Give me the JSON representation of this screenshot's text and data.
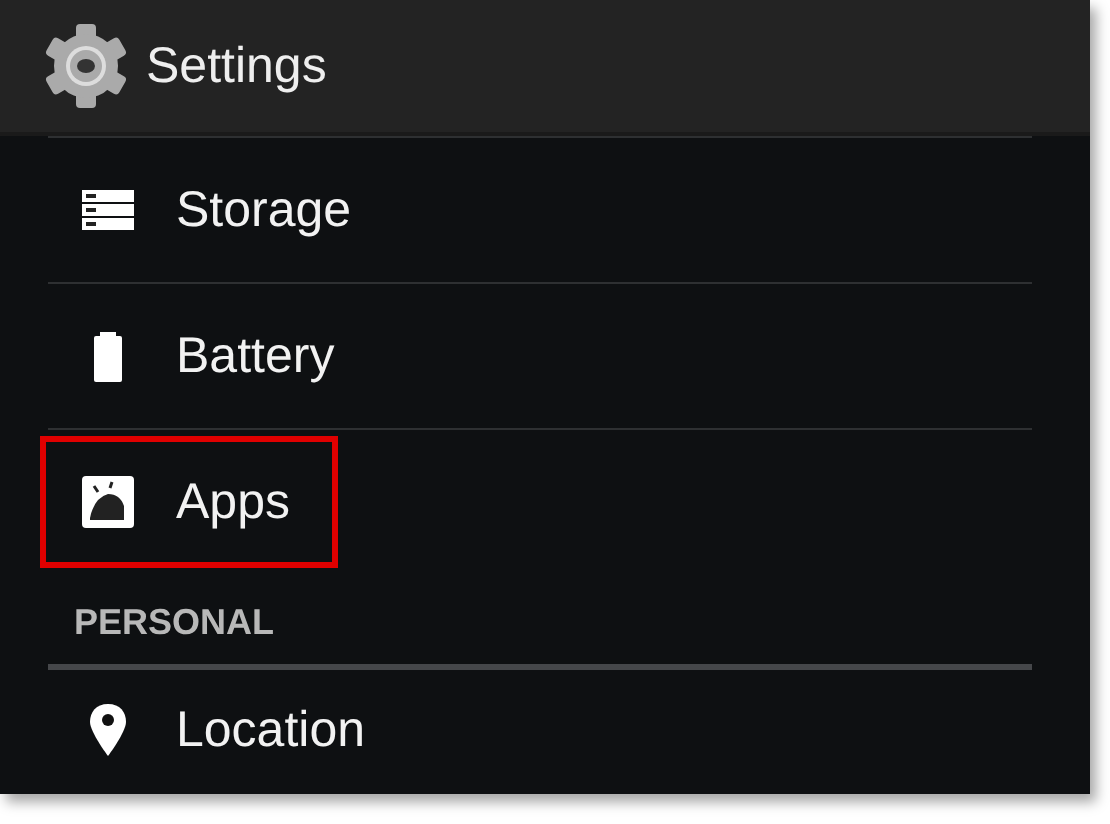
{
  "window": {
    "title": "Settings"
  },
  "items": [
    {
      "label": "Storage",
      "kind": "storage",
      "highlighted": false
    },
    {
      "label": "Battery",
      "kind": "battery",
      "highlighted": false
    },
    {
      "label": "Apps",
      "kind": "apps",
      "highlighted": true
    }
  ],
  "section": {
    "title": "PERSONAL",
    "items": [
      {
        "label": "Location",
        "kind": "location",
        "highlighted": false
      }
    ]
  }
}
